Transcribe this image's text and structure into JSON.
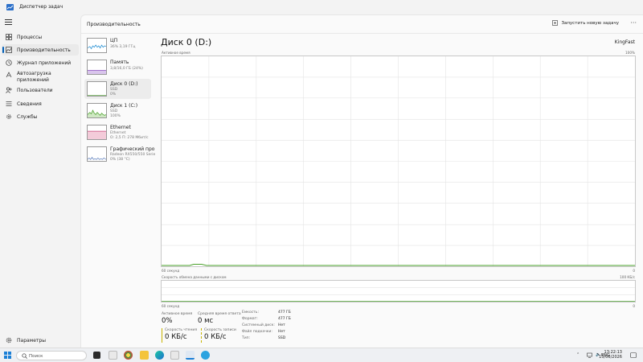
{
  "window": {
    "title": "Диспетчер задач"
  },
  "nav": {
    "items": [
      {
        "label": "Процессы",
        "icon": "grid-icon"
      },
      {
        "label": "Производительность",
        "icon": "performance-chart-icon"
      },
      {
        "label": "Журнал приложений",
        "icon": "history-icon"
      },
      {
        "label": "Автозагрузка приложений",
        "label_line1": "Автозагрузка",
        "label_line2": "приложений",
        "icon": "startup-icon"
      },
      {
        "label": "Пользователи",
        "icon": "users-icon"
      },
      {
        "label": "Сведения",
        "icon": "details-list-icon"
      },
      {
        "label": "Службы",
        "icon": "services-gear-icon"
      }
    ],
    "settings_label": "Параметры"
  },
  "header": {
    "title": "Производительность",
    "run_task_label": "Запустить новую задачу",
    "more_label": "···"
  },
  "perf_list": [
    {
      "name": "ЦП",
      "sub1": "36%  3,19 ГГц",
      "sub2": ""
    },
    {
      "name": "Память",
      "sub1": "3,8/16,0 ГБ (24%)",
      "sub2": ""
    },
    {
      "name": "Диск 0 (D:)",
      "sub1": "SSD",
      "sub2": "0%"
    },
    {
      "name": "Диск 1 (C:)",
      "sub1": "SSD",
      "sub2": "100%"
    },
    {
      "name": "Ethernet",
      "sub1": "Ethernet",
      "sub2": "О: 2,5  П: 278 Мбит/с"
    },
    {
      "name": "Графический про",
      "sub1": "Radeon RX550/550 Serie",
      "sub2": "0% (38 °C)"
    }
  ],
  "detail": {
    "title": "Диск 0 (D:)",
    "model": "KingFast",
    "graph1_label": "Активное время",
    "graph1_max": "100%",
    "graph1_time": "60 секунд",
    "graph1_min": "0",
    "graph2_label": "Скорость обмена данными с диском",
    "graph2_max": "100 КБ/с",
    "graph2_time": "60 секунд",
    "graph2_min": "0",
    "active_time_label": "Активное время",
    "active_time_value": "0%",
    "avg_response_label": "Средняя время ответа",
    "avg_response_value": "0 мс",
    "read_speed_label": "Скорость чтения",
    "read_speed_value": "0 КБ/с",
    "write_speed_label": "Скорость записи",
    "write_speed_value": "0 КБ/с",
    "props": [
      {
        "label": "Емкость:",
        "value": "477 ГБ"
      },
      {
        "label": "Формат:",
        "value": "477 ГБ"
      },
      {
        "label": "Системный диск:",
        "value": "Нет"
      },
      {
        "label": "Файл подкачки:",
        "value": "Нет"
      },
      {
        "label": "Тип:",
        "value": "SSD"
      }
    ]
  },
  "taskbar": {
    "search_placeholder": "Поиск",
    "lang": "ENG",
    "time": "13:22:13",
    "date": "15/06/2026"
  },
  "colors": {
    "accent": "#005fb8",
    "cpu": "#1a8ad1",
    "memory": "#8a4bbf",
    "disk": "#4aa12b",
    "ethernet": "#c7477a",
    "gpu": "#4a6fb5"
  }
}
